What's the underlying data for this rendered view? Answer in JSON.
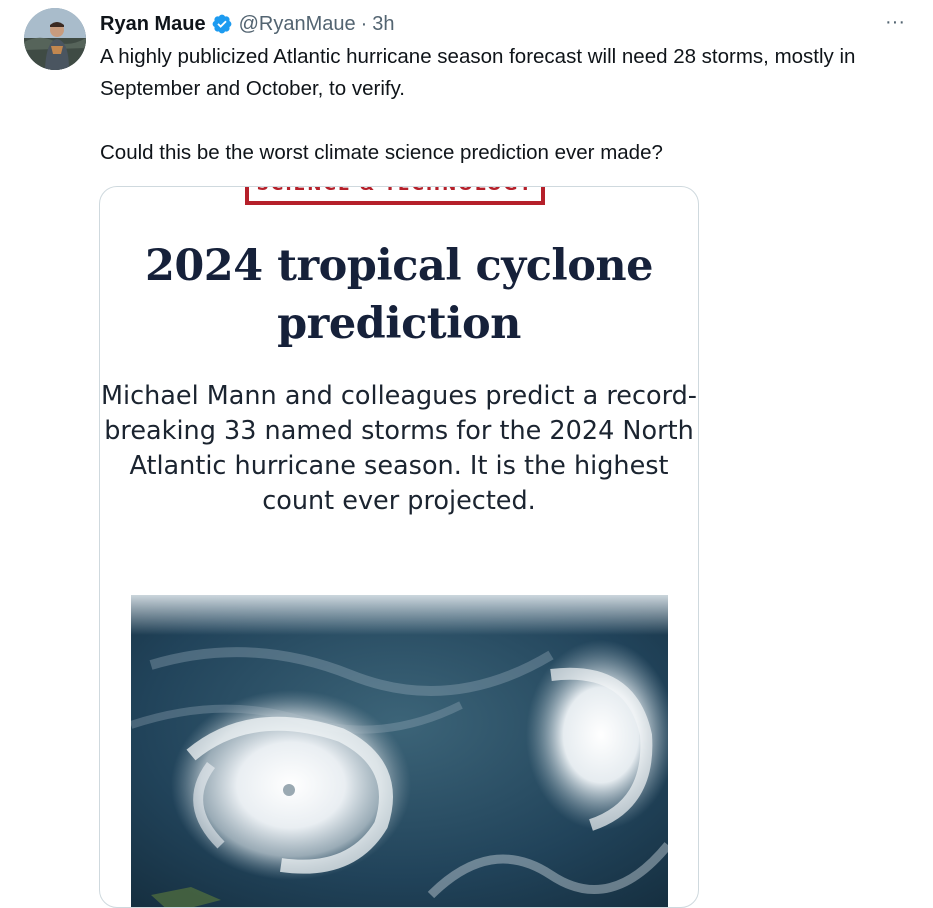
{
  "tweet": {
    "author": {
      "display_name": "Ryan Maue",
      "handle": "@RyanMaue",
      "separator": "·",
      "time": "3h",
      "verified": true,
      "avatar_icon": "user-avatar-photo"
    },
    "more_label": "···",
    "text_paragraphs": [
      "A highly publicized Atlantic hurricane season forecast will need 28 storms, mostly in September and October, to verify.",
      "Could this be the worst climate science prediction ever made?"
    ],
    "media": {
      "category": "SCIENCE & TECHNOLOGY",
      "headline": "2024 tropical cyclone prediction",
      "deck": "Michael Mann and colleagues predict a record-breaking 33 named storms for the 2024 North Atlantic hurricane season. It is the highest count ever projected.",
      "image_icon": "satellite-hurricane-image",
      "accent_color": "#b5202a",
      "headline_color": "#16213a"
    }
  },
  "colors": {
    "text_primary": "#0f1419",
    "text_secondary": "#536471",
    "verified_blue": "#1d9bf0",
    "card_border": "#cfd9de"
  }
}
